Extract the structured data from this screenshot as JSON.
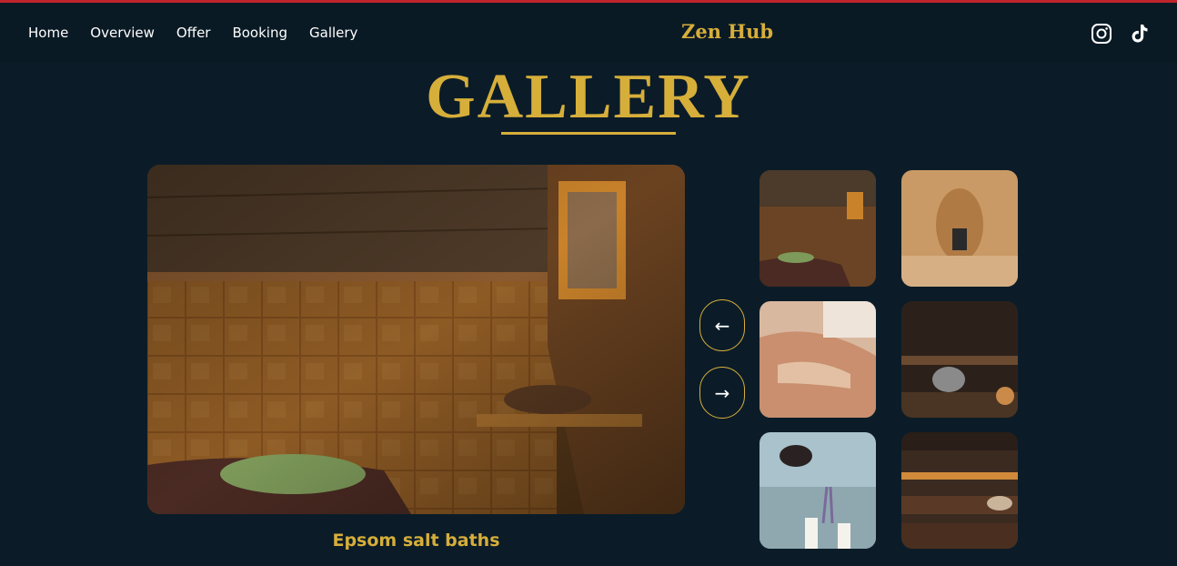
{
  "nav": {
    "items": [
      "Home",
      "Overview",
      "Offer",
      "Booking",
      "Gallery"
    ]
  },
  "brand": "Zen Hub",
  "social": {
    "icons": [
      "instagram-icon",
      "tiktok-icon"
    ]
  },
  "gallery": {
    "title": "GALLERY",
    "caption": "Epsom salt baths",
    "prev_label": "←",
    "next_label": "→"
  },
  "colors": {
    "background": "#0b1c28",
    "accent": "#d6ae3a",
    "top_border": "#c0242b"
  }
}
